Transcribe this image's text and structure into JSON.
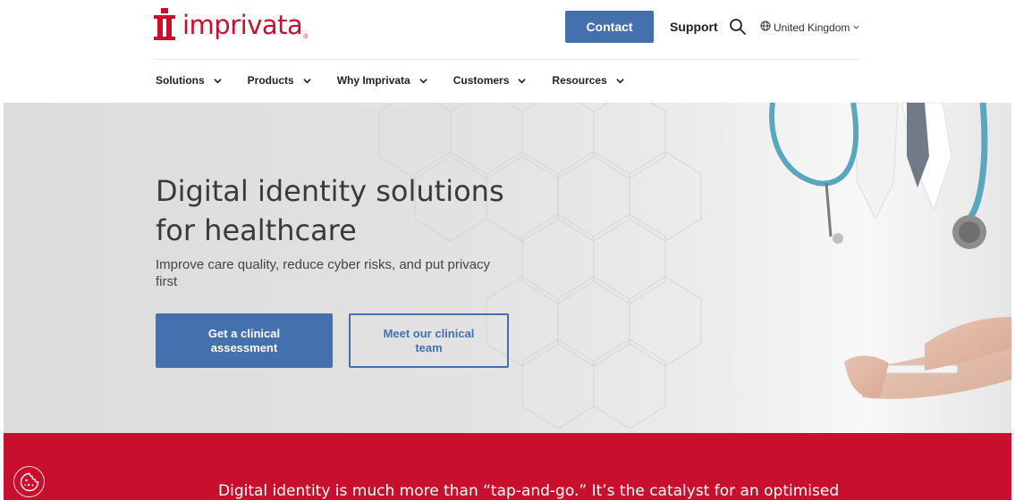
{
  "header": {
    "logo_text": "imprivata",
    "logo_tm": "®",
    "contact_label": "Contact",
    "support_label": "Support",
    "region_label": "United Kingdom"
  },
  "nav": {
    "items": [
      {
        "label": "Solutions"
      },
      {
        "label": "Products"
      },
      {
        "label": "Why Imprivata"
      },
      {
        "label": "Customers"
      },
      {
        "label": "Resources"
      }
    ]
  },
  "hero": {
    "title": "Digital identity solutions for healthcare",
    "subtitle": "Improve care quality, reduce cyber risks, and put privacy first",
    "primary_button": "Get a clinical assessment",
    "secondary_button": "Meet our clinical team"
  },
  "band": {
    "text": "Digital identity is much more than “tap-and-go.” It’s the catalyst for an optimised"
  },
  "colors": {
    "brand_red": "#c8102e",
    "primary_blue": "#4470ad",
    "hero_bg": "#e2e2e2"
  },
  "icons": {
    "search": "search-icon",
    "globe": "globe-icon",
    "chevron": "chevron-down-icon",
    "cookie": "cookie-icon"
  }
}
